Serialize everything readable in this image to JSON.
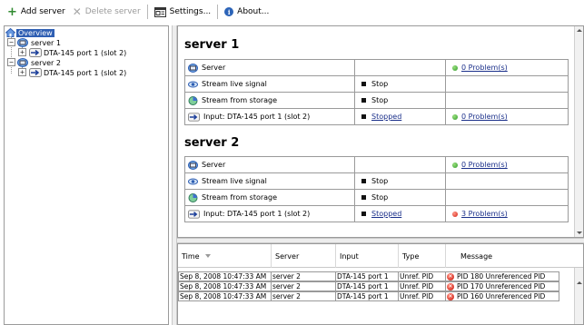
{
  "toolbar": {
    "add_server": "Add server",
    "delete_server": "Delete server",
    "settings": "Settings...",
    "about": "About..."
  },
  "tree": {
    "overview": "Overview",
    "servers": [
      {
        "label": "server 1",
        "children": [
          "DTA-145 port 1 (slot 2)"
        ]
      },
      {
        "label": "server 2",
        "children": [
          "DTA-145 port 1 (slot 2)"
        ]
      }
    ]
  },
  "servers": [
    {
      "title": "server 1",
      "rows": [
        {
          "label": "Server",
          "icon": "server-icon",
          "status": "",
          "problems": "0 Problem(s)",
          "problem_color": "green"
        },
        {
          "label": "Stream live signal",
          "icon": "eye-icon",
          "status": "Stop",
          "problems": "",
          "problem_color": ""
        },
        {
          "label": "Stream from storage",
          "icon": "storage-stream-icon",
          "status": "Stop",
          "problems": "",
          "problem_color": ""
        },
        {
          "label": "Input: DTA-145 port 1 (slot 2)",
          "icon": "input-arrow-icon",
          "status": "Stopped",
          "problems": "0 Problem(s)",
          "problem_color": "green"
        }
      ]
    },
    {
      "title": "server 2",
      "rows": [
        {
          "label": "Server",
          "icon": "server-icon",
          "status": "",
          "problems": "0 Problem(s)",
          "problem_color": "green"
        },
        {
          "label": "Stream live signal",
          "icon": "eye-icon",
          "status": "Stop",
          "problems": "",
          "problem_color": ""
        },
        {
          "label": "Stream from storage",
          "icon": "storage-stream-icon",
          "status": "Stop",
          "problems": "",
          "problem_color": ""
        },
        {
          "label": "Input: DTA-145 port 1 (slot 2)",
          "icon": "input-arrow-icon",
          "status": "Stopped",
          "problems": "3 Problem(s)",
          "problem_color": "red"
        }
      ]
    }
  ],
  "log": {
    "columns": [
      "Time",
      "Server",
      "Input",
      "Type",
      "Message"
    ],
    "rows": [
      {
        "time": "Sep 8, 2008 10:47:33 AM",
        "server": "server 2",
        "input": "DTA-145 port 1",
        "type": "Unref. PID",
        "message": "PID 180 Unreferenced PID"
      },
      {
        "time": "Sep 8, 2008 10:47:33 AM",
        "server": "server 2",
        "input": "DTA-145 port 1",
        "type": "Unref. PID",
        "message": "PID 170 Unreferenced PID"
      },
      {
        "time": "Sep 8, 2008 10:47:33 AM",
        "server": "server 2",
        "input": "DTA-145 port 1",
        "type": "Unref. PID",
        "message": "PID 160 Unreferenced PID"
      }
    ]
  },
  "colors": {
    "selection": "#2f5fb3",
    "link": "#1a2f8a",
    "ok": "#2f9a2a",
    "error": "#d21f14"
  }
}
